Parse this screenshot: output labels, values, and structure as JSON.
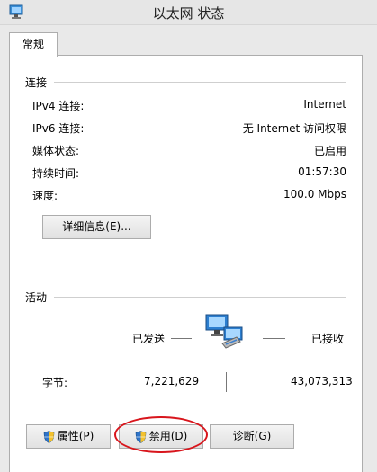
{
  "window": {
    "title": "以太网 状态"
  },
  "tabs": [
    {
      "label": "常规"
    }
  ],
  "connection": {
    "heading": "连接",
    "rows": [
      {
        "label": "IPv4 连接:",
        "value": "Internet"
      },
      {
        "label": "IPv6 连接:",
        "value": "无 Internet 访问权限"
      },
      {
        "label": "媒体状态:",
        "value": "已启用"
      },
      {
        "label": "持续时间:",
        "value": "01:57:30"
      },
      {
        "label": "速度:",
        "value": "100.0 Mbps"
      }
    ],
    "details_button": "详细信息(E)..."
  },
  "activity": {
    "heading": "活动",
    "sent_label": "已发送",
    "received_label": "已接收",
    "bytes_label": "字节:",
    "bytes_sent": "7,221,629",
    "bytes_received": "43,073,313"
  },
  "buttons": {
    "properties": "属性(P)",
    "disable": "禁用(D)",
    "diagnose": "诊断(G)"
  },
  "colors": {
    "highlight": "#d8151c",
    "window_bg": "#e9e9e9",
    "panel_bg": "#ffffff"
  },
  "icons": [
    "network-adapter-icon",
    "network-computers-icon",
    "uac-shield-icon"
  ]
}
